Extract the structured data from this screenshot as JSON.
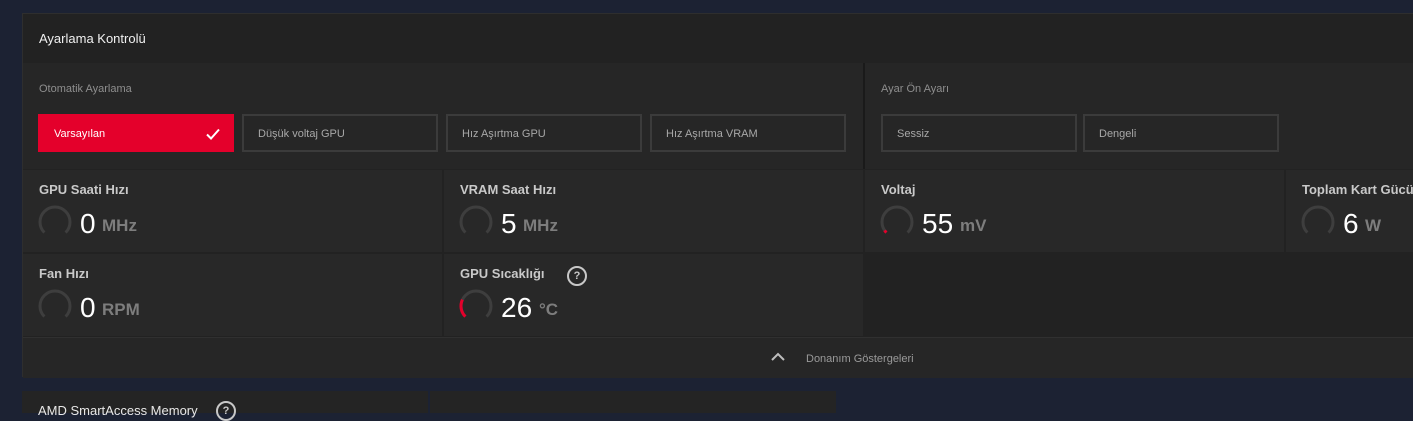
{
  "panel": {
    "title": "Ayarlama Kontrolü"
  },
  "auto_tuning": {
    "label": "Otomatik Ayarlama",
    "options": [
      {
        "label": "Varsayılan",
        "selected": true
      },
      {
        "label": "Düşük voltaj GPU",
        "selected": false
      },
      {
        "label": "Hız Aşırtma GPU",
        "selected": false
      },
      {
        "label": "Hız Aşırtma VRAM",
        "selected": false
      }
    ]
  },
  "preset": {
    "label": "Ayar Ön Ayarı",
    "options": [
      {
        "label": "Sessiz",
        "selected": false
      },
      {
        "label": "Dengeli",
        "selected": false
      }
    ]
  },
  "metrics": {
    "gpu_clock": {
      "title": "GPU Saati Hızı",
      "value": "0",
      "unit": "MHz",
      "level": 0.0
    },
    "vram_clock": {
      "title": "VRAM Saat Hızı",
      "value": "5",
      "unit": "MHz",
      "level": 0.0
    },
    "voltage": {
      "title": "Voltaj",
      "value": "55",
      "unit": "mV",
      "level": 0.04
    },
    "board_power": {
      "title": "Toplam Kart Gücü",
      "value": "6",
      "unit": "W",
      "level": 0.0
    },
    "fan_speed": {
      "title": "Fan Hızı",
      "value": "0",
      "unit": "RPM",
      "level": 0.0
    },
    "gpu_temp": {
      "title": "GPU Sıcaklığı",
      "value": "26",
      "unit": "°C",
      "level": 0.26
    }
  },
  "help_glyph": "?",
  "footer": {
    "label": "Donanım Göstergeleri",
    "icon": "chevron-up-icon"
  },
  "smart_access": {
    "title": "AMD SmartAccess Memory"
  },
  "colors": {
    "accent": "#e4002b",
    "background": "#1c2233",
    "panel": "#222222"
  }
}
